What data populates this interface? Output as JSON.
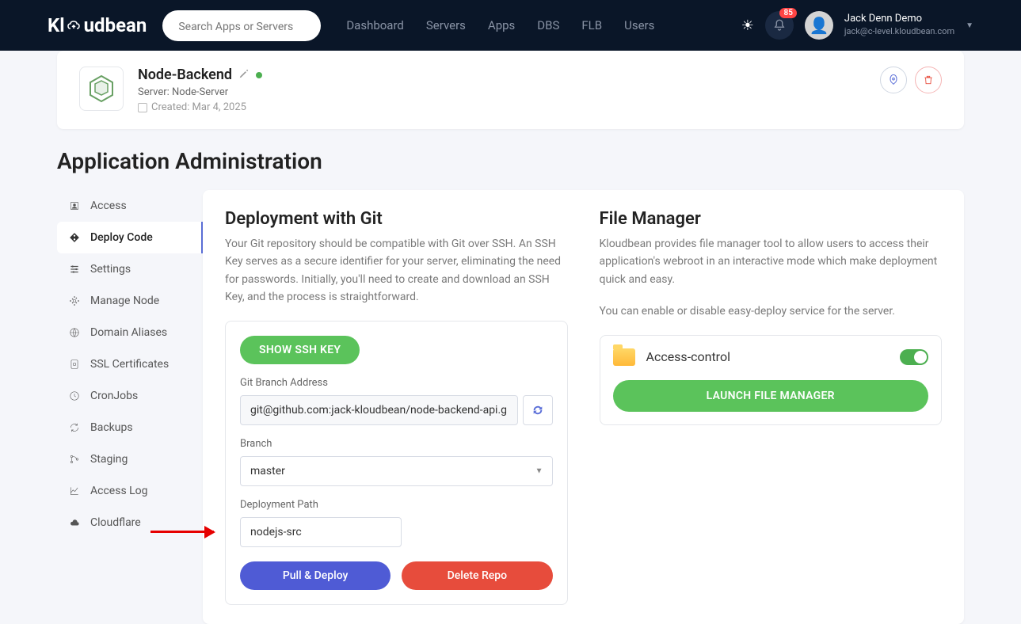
{
  "topbar": {
    "logo": "Kloudbean",
    "search_placeholder": "Search Apps or Servers",
    "nav": [
      "Dashboard",
      "Servers",
      "Apps",
      "DBS",
      "FLB",
      "Users"
    ],
    "notif_count": "85",
    "user_name": "Jack Denn Demo",
    "user_email": "jack@c-level.kloudbean.com"
  },
  "app": {
    "title": "Node-Backend",
    "server_label": "Server: Node-Server",
    "created_label": "Created: Mar 4, 2025"
  },
  "page_title": "Application Administration",
  "sidebar": {
    "items": [
      {
        "label": "Access"
      },
      {
        "label": "Deploy Code"
      },
      {
        "label": "Settings"
      },
      {
        "label": "Manage Node"
      },
      {
        "label": "Domain Aliases"
      },
      {
        "label": "SSL Certificates"
      },
      {
        "label": "CronJobs"
      },
      {
        "label": "Backups"
      },
      {
        "label": "Staging"
      },
      {
        "label": "Access Log"
      },
      {
        "label": "Cloudflare"
      }
    ]
  },
  "git": {
    "title": "Deployment with Git",
    "desc": "Your Git repository should be compatible with Git over SSH. An SSH Key serves as a secure identifier for your server, eliminating the need for passwords. Initially, you'll need to create and download an SSH Key, and the process is straightforward.",
    "show_ssh": "SHOW SSH KEY",
    "branch_addr_label": "Git Branch Address",
    "branch_addr_value": "git@github.com:jack-kloudbean/node-backend-api.git",
    "branch_label": "Branch",
    "branch_value": "master",
    "deploy_path_label": "Deployment Path",
    "deploy_path_value": "nodejs-src",
    "pull_deploy": "Pull & Deploy",
    "delete_repo": "Delete Repo"
  },
  "fm": {
    "title": "File Manager",
    "desc1": "Kloudbean provides file manager tool to allow users to access their application's webroot in an interactive mode which make deployment quick and easy.",
    "desc2": "You can enable or disable easy-deploy service for the server.",
    "access_control": "Access-control",
    "launch": "LAUNCH FILE MANAGER"
  }
}
